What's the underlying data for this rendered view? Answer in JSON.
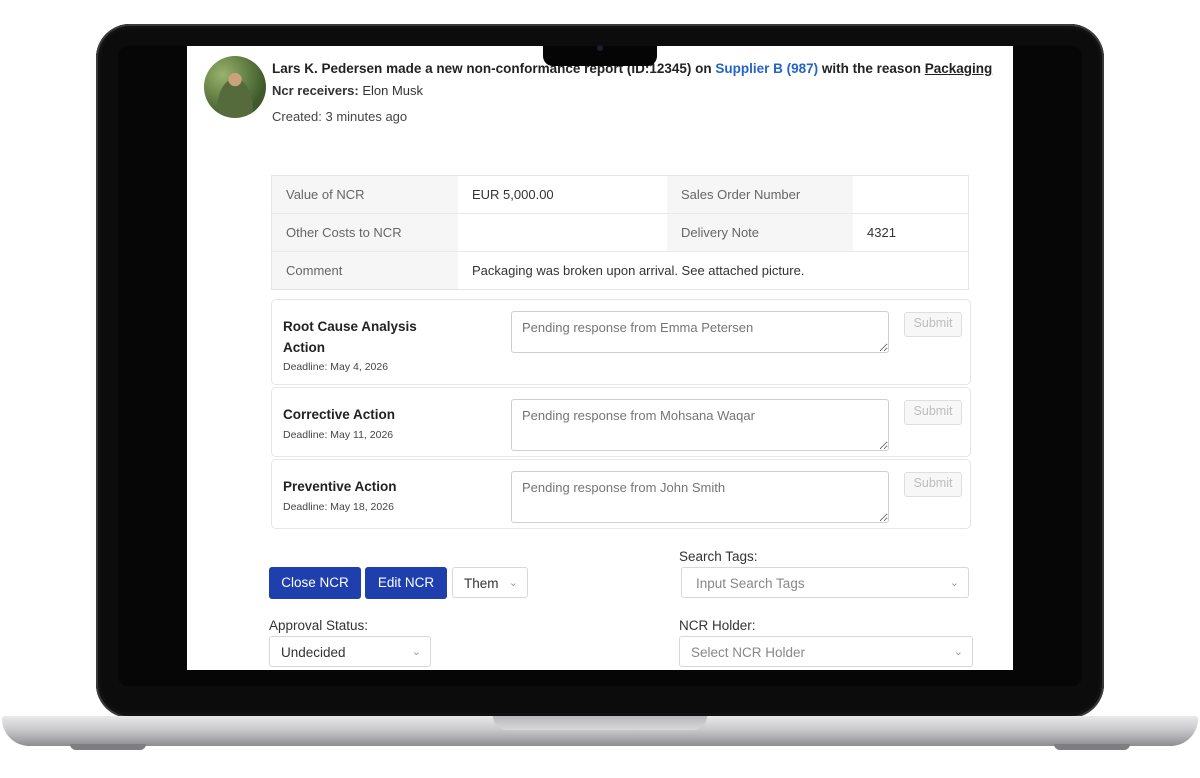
{
  "notification": {
    "author": "Lars K. Pedersen",
    "text_made": " made a new non-conformance report (ID:12345) on ",
    "supplier": "Supplier B (987)",
    "text_reason": " with the reason ",
    "reason": "Packaging",
    "receivers_label": "Ncr receivers:",
    "receivers": " Elon Musk",
    "created": "Created: 3 minutes ago"
  },
  "info": {
    "value_label": "Value of NCR",
    "value": "EUR 5,000.00",
    "sales_order_label": "Sales Order Number",
    "sales_order": "",
    "other_costs_label": "Other Costs to NCR",
    "other_costs": "",
    "delivery_note_label": "Delivery Note",
    "delivery_note": "4321",
    "comment_label": "Comment",
    "comment": "Packaging was broken upon arrival. See attached picture."
  },
  "actions": [
    {
      "title": "Root Cause Analysis Action",
      "deadline": "Deadline: May 4, 2026",
      "placeholder": "Pending response from Emma Petersen",
      "submit": "Submit"
    },
    {
      "title": "Corrective Action",
      "deadline": "Deadline: May 11, 2026",
      "placeholder": "Pending response from Mohsana Waqar",
      "submit": "Submit"
    },
    {
      "title": "Preventive Action",
      "deadline": "Deadline: May 18, 2026",
      "placeholder": "Pending response from John Smith",
      "submit": "Submit"
    }
  ],
  "controls": {
    "close_label": "Close NCR",
    "edit_label": "Edit NCR",
    "them_label": "Them",
    "search_tags_label": "Search Tags:",
    "search_tags_placeholder": "Input Search Tags",
    "approval_label": "Approval Status:",
    "approval_value": "Undecided",
    "holder_label": "NCR Holder:",
    "holder_placeholder": "Select NCR Holder"
  },
  "colors": {
    "primary_button": "#1f3fae",
    "link": "#2563c9"
  },
  "icons": {
    "dropdown": "chevron-down-icon"
  }
}
